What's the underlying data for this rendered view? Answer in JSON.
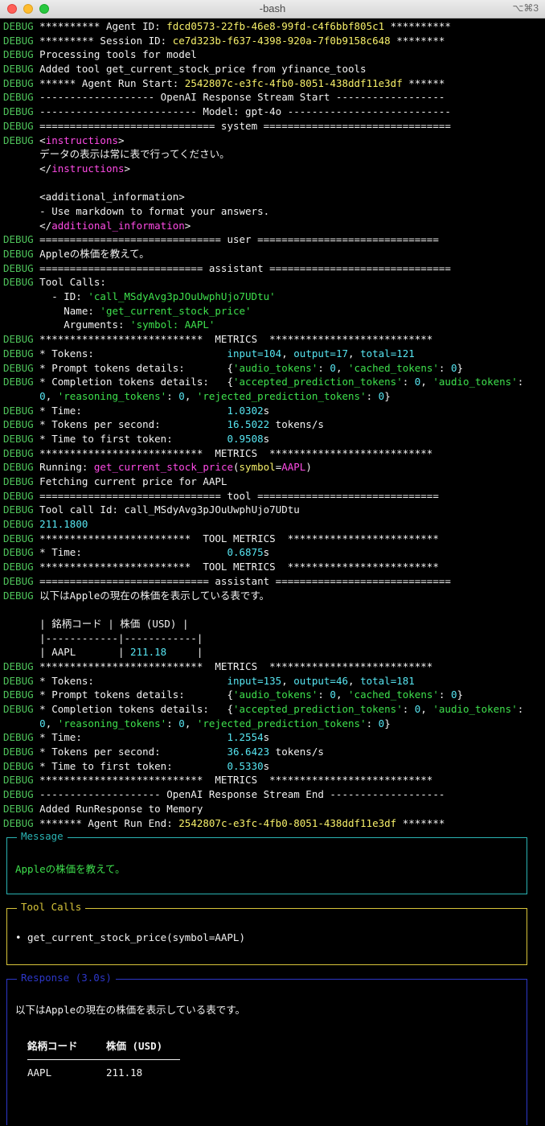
{
  "window": {
    "title": "-bash",
    "shortcut": "⌥⌘3"
  },
  "colors": {
    "debug": "#4ec25a",
    "yellow": "#f7f06a",
    "magenta": "#ff4be6",
    "green": "#3ee04d",
    "cyan": "#57e6f2",
    "message_border": "#2ab3b3",
    "toolcalls_border": "#d8c53a",
    "response_border": "#2d37c9"
  },
  "log_lines": [
    [
      [
        "tag",
        "DEBUG"
      ],
      [
        "w",
        " ********** Agent ID: "
      ],
      [
        "y",
        "fdcd0573-22fb-46e8-99fd-c4f6bbf805c1"
      ],
      [
        "w",
        " **********"
      ]
    ],
    [
      [
        "tag",
        "DEBUG"
      ],
      [
        "w",
        " ********* Session ID: "
      ],
      [
        "y",
        "ce7d323b-f637-4398-920a-7f0b9158c648"
      ],
      [
        "w",
        " ********"
      ]
    ],
    [
      [
        "tag",
        "DEBUG"
      ],
      [
        "w",
        " Processing tools for model"
      ]
    ],
    [
      [
        "tag",
        "DEBUG"
      ],
      [
        "w",
        " Added tool get_current_stock_price from yfinance_tools"
      ]
    ],
    [
      [
        "tag",
        "DEBUG"
      ],
      [
        "w",
        " ****** Agent Run Start: "
      ],
      [
        "y",
        "2542807c-e3fc-4fb0-8051-438ddf11e3df"
      ],
      [
        "w",
        " ******"
      ]
    ],
    [
      [
        "tag",
        "DEBUG"
      ],
      [
        "w",
        " ------------------- OpenAI Response Stream Start ------------------"
      ]
    ],
    [
      [
        "tag",
        "DEBUG"
      ],
      [
        "w",
        " -------------------------- Model: gpt-4o ---------------------------"
      ]
    ],
    [
      [
        "tag",
        "DEBUG"
      ],
      [
        "w",
        " ============================= system ==============================="
      ]
    ],
    [
      [
        "tag",
        "DEBUG"
      ],
      [
        "w",
        " <"
      ],
      [
        "m",
        "instructions"
      ],
      [
        "w",
        ">"
      ]
    ],
    [
      [
        "w",
        "      データの表示は常に表で行ってください。"
      ]
    ],
    [
      [
        "w",
        "      </"
      ],
      [
        "m",
        "instructions"
      ],
      [
        "w",
        ">"
      ]
    ],
    [
      [
        "w",
        ""
      ]
    ],
    [
      [
        "w",
        "      <additional_information>"
      ]
    ],
    [
      [
        "w",
        "      - Use markdown to format your answers."
      ]
    ],
    [
      [
        "w",
        "      </"
      ],
      [
        "m",
        "additional_information"
      ],
      [
        "w",
        ">"
      ]
    ],
    [
      [
        "tag",
        "DEBUG"
      ],
      [
        "w",
        " ============================== user =============================="
      ]
    ],
    [
      [
        "tag",
        "DEBUG"
      ],
      [
        "w",
        " Appleの株価を教えて。"
      ]
    ],
    [
      [
        "tag",
        "DEBUG"
      ],
      [
        "w",
        " =========================== assistant =============================="
      ]
    ],
    [
      [
        "tag",
        "DEBUG"
      ],
      [
        "w",
        " Tool Calls:"
      ]
    ],
    [
      [
        "w",
        "        - ID: "
      ],
      [
        "g",
        "'call_MSdyAvg3pJOuUwphUjo7UDtu'"
      ]
    ],
    [
      [
        "w",
        "          Name: "
      ],
      [
        "g",
        "'get_current_stock_price'"
      ]
    ],
    [
      [
        "w",
        "          Arguments: "
      ],
      [
        "g",
        "'symbol: AAPL'"
      ]
    ],
    [
      [
        "tag",
        "DEBUG"
      ],
      [
        "w",
        " ***************************  METRICS  ***************************"
      ]
    ],
    [
      [
        "tag",
        "DEBUG"
      ],
      [
        "w",
        " * Tokens:                      "
      ],
      [
        "c",
        "input=104"
      ],
      [
        "w",
        ", "
      ],
      [
        "c",
        "output=17"
      ],
      [
        "w",
        ", "
      ],
      [
        "c",
        "total=121"
      ]
    ],
    [
      [
        "tag",
        "DEBUG"
      ],
      [
        "w",
        " * Prompt tokens details:       {"
      ],
      [
        "g",
        "'audio_tokens'"
      ],
      [
        "w",
        ": "
      ],
      [
        "c",
        "0"
      ],
      [
        "w",
        ", "
      ],
      [
        "g",
        "'cached_tokens'"
      ],
      [
        "w",
        ": "
      ],
      [
        "c",
        "0"
      ],
      [
        "w",
        "}"
      ]
    ],
    [
      [
        "tag",
        "DEBUG"
      ],
      [
        "w",
        " * Completion tokens details:   {"
      ],
      [
        "g",
        "'accepted_prediction_tokens'"
      ],
      [
        "w",
        ": "
      ],
      [
        "c",
        "0"
      ],
      [
        "w",
        ", "
      ],
      [
        "g",
        "'audio_tokens'"
      ],
      [
        "w",
        ":"
      ]
    ],
    [
      [
        "w",
        "      "
      ],
      [
        "c",
        "0"
      ],
      [
        "w",
        ", "
      ],
      [
        "g",
        "'reasoning_tokens'"
      ],
      [
        "w",
        ": "
      ],
      [
        "c",
        "0"
      ],
      [
        "w",
        ", "
      ],
      [
        "g",
        "'rejected_prediction_tokens'"
      ],
      [
        "w",
        ": "
      ],
      [
        "c",
        "0"
      ],
      [
        "w",
        "}"
      ]
    ],
    [
      [
        "tag",
        "DEBUG"
      ],
      [
        "w",
        " * Time:                        "
      ],
      [
        "c",
        "1.0302"
      ],
      [
        "w",
        "s"
      ]
    ],
    [
      [
        "tag",
        "DEBUG"
      ],
      [
        "w",
        " * Tokens per second:           "
      ],
      [
        "c",
        "16.5022"
      ],
      [
        "w",
        " tokens/s"
      ]
    ],
    [
      [
        "tag",
        "DEBUG"
      ],
      [
        "w",
        " * Time to first token:         "
      ],
      [
        "c",
        "0.9508"
      ],
      [
        "w",
        "s"
      ]
    ],
    [
      [
        "tag",
        "DEBUG"
      ],
      [
        "w",
        " ***************************  METRICS  ***************************"
      ]
    ],
    [
      [
        "tag",
        "DEBUG"
      ],
      [
        "w",
        " Running: "
      ],
      [
        "m",
        "get_current_stock_price"
      ],
      [
        "w",
        "("
      ],
      [
        "y",
        "symbol"
      ],
      [
        "w",
        "="
      ],
      [
        "m",
        "AAPL"
      ],
      [
        "w",
        ")"
      ]
    ],
    [
      [
        "tag",
        "DEBUG"
      ],
      [
        "w",
        " Fetching current price for AAPL"
      ]
    ],
    [
      [
        "tag",
        "DEBUG"
      ],
      [
        "w",
        " ============================== tool =============================="
      ]
    ],
    [
      [
        "tag",
        "DEBUG"
      ],
      [
        "w",
        " Tool call Id: call_MSdyAvg3pJOuUwphUjo7UDtu"
      ]
    ],
    [
      [
        "tag",
        "DEBUG"
      ],
      [
        "c",
        " 211.1800"
      ]
    ],
    [
      [
        "tag",
        "DEBUG"
      ],
      [
        "w",
        " *************************  TOOL METRICS  *************************"
      ]
    ],
    [
      [
        "tag",
        "DEBUG"
      ],
      [
        "w",
        " * Time:                        "
      ],
      [
        "c",
        "0.6875"
      ],
      [
        "w",
        "s"
      ]
    ],
    [
      [
        "tag",
        "DEBUG"
      ],
      [
        "w",
        " *************************  TOOL METRICS  *************************"
      ]
    ],
    [
      [
        "tag",
        "DEBUG"
      ],
      [
        "w",
        " ============================ assistant ============================="
      ]
    ],
    [
      [
        "tag",
        "DEBUG"
      ],
      [
        "w",
        " 以下はAppleの現在の株価を表示している表です。"
      ]
    ],
    [
      [
        "w",
        ""
      ]
    ],
    [
      [
        "w",
        "      | 銘柄コード | 株価 (USD) |"
      ]
    ],
    [
      [
        "w",
        "      |------------|------------|"
      ]
    ],
    [
      [
        "w",
        "      | AAPL       | "
      ],
      [
        "c",
        "211.18"
      ],
      [
        "w",
        "     |"
      ]
    ],
    [
      [
        "tag",
        "DEBUG"
      ],
      [
        "w",
        " ***************************  METRICS  ***************************"
      ]
    ],
    [
      [
        "tag",
        "DEBUG"
      ],
      [
        "w",
        " * Tokens:                      "
      ],
      [
        "c",
        "input=135"
      ],
      [
        "w",
        ", "
      ],
      [
        "c",
        "output=46"
      ],
      [
        "w",
        ", "
      ],
      [
        "c",
        "total=181"
      ]
    ],
    [
      [
        "tag",
        "DEBUG"
      ],
      [
        "w",
        " * Prompt tokens details:       {"
      ],
      [
        "g",
        "'audio_tokens'"
      ],
      [
        "w",
        ": "
      ],
      [
        "c",
        "0"
      ],
      [
        "w",
        ", "
      ],
      [
        "g",
        "'cached_tokens'"
      ],
      [
        "w",
        ": "
      ],
      [
        "c",
        "0"
      ],
      [
        "w",
        "}"
      ]
    ],
    [
      [
        "tag",
        "DEBUG"
      ],
      [
        "w",
        " * Completion tokens details:   {"
      ],
      [
        "g",
        "'accepted_prediction_tokens'"
      ],
      [
        "w",
        ": "
      ],
      [
        "c",
        "0"
      ],
      [
        "w",
        ", "
      ],
      [
        "g",
        "'audio_tokens'"
      ],
      [
        "w",
        ":"
      ]
    ],
    [
      [
        "w",
        "      "
      ],
      [
        "c",
        "0"
      ],
      [
        "w",
        ", "
      ],
      [
        "g",
        "'reasoning_tokens'"
      ],
      [
        "w",
        ": "
      ],
      [
        "c",
        "0"
      ],
      [
        "w",
        ", "
      ],
      [
        "g",
        "'rejected_prediction_tokens'"
      ],
      [
        "w",
        ": "
      ],
      [
        "c",
        "0"
      ],
      [
        "w",
        "}"
      ]
    ],
    [
      [
        "tag",
        "DEBUG"
      ],
      [
        "w",
        " * Time:                        "
      ],
      [
        "c",
        "1.2554"
      ],
      [
        "w",
        "s"
      ]
    ],
    [
      [
        "tag",
        "DEBUG"
      ],
      [
        "w",
        " * Tokens per second:           "
      ],
      [
        "c",
        "36.6423"
      ],
      [
        "w",
        " tokens/s"
      ]
    ],
    [
      [
        "tag",
        "DEBUG"
      ],
      [
        "w",
        " * Time to first token:         "
      ],
      [
        "c",
        "0.5330"
      ],
      [
        "w",
        "s"
      ]
    ],
    [
      [
        "tag",
        "DEBUG"
      ],
      [
        "w",
        " ***************************  METRICS  ***************************"
      ]
    ],
    [
      [
        "tag",
        "DEBUG"
      ],
      [
        "w",
        " -------------------- OpenAI Response Stream End -------------------"
      ]
    ],
    [
      [
        "tag",
        "DEBUG"
      ],
      [
        "w",
        " Added RunResponse to Memory"
      ]
    ],
    [
      [
        "tag",
        "DEBUG"
      ],
      [
        "w",
        " ******* Agent Run End: "
      ],
      [
        "y",
        "2542807c-e3fc-4fb0-8051-438ddf11e3df"
      ],
      [
        "w",
        " *******"
      ]
    ]
  ],
  "panels": {
    "message": {
      "title": "Message",
      "text": "Appleの株価を教えて。"
    },
    "tool_calls": {
      "title": "Tool Calls",
      "item": "• get_current_stock_price(symbol=AAPL)"
    },
    "response": {
      "title": "Response (3.0s)",
      "intro": "以下はAppleの現在の株価を表示している表です。",
      "table": {
        "headers": [
          "銘柄コード",
          "株価 (USD)"
        ],
        "rows": [
          [
            "AAPL",
            "211.18"
          ]
        ]
      }
    }
  }
}
